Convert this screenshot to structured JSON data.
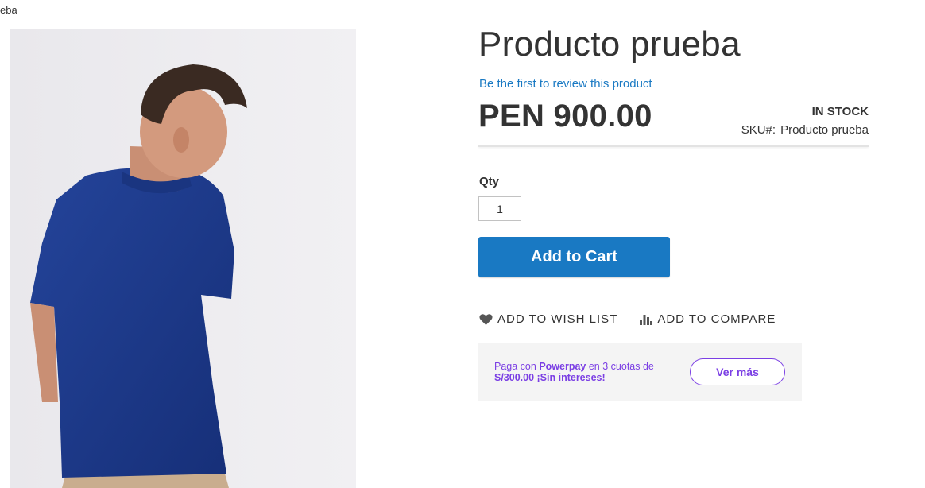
{
  "breadcrumb": {
    "current": "eba"
  },
  "product": {
    "name": "Producto prueba",
    "review_link": "Be the first to review this product",
    "price": "PEN 900.00",
    "stock_status": "IN STOCK",
    "sku_label": "SKU#:",
    "sku_value": "Producto prueba"
  },
  "form": {
    "qty_label": "Qty",
    "qty_value": "1",
    "add_to_cart": "Add to Cart"
  },
  "actions": {
    "wishlist": "ADD TO WISH LIST",
    "compare": "ADD TO COMPARE"
  },
  "powerpay": {
    "prefix": "Paga con",
    "brand": "Powerpay",
    "suffix": "en 3 cuotas de",
    "line2": "S/300.00 ¡Sin intereses!",
    "button": "Ver más"
  },
  "colors": {
    "accent": "#1979c3",
    "powerpay": "#7b3fe4",
    "shirt": "#1f3a8a"
  },
  "icons": {
    "wishlist": "heart-icon",
    "compare": "bar-chart-icon"
  }
}
